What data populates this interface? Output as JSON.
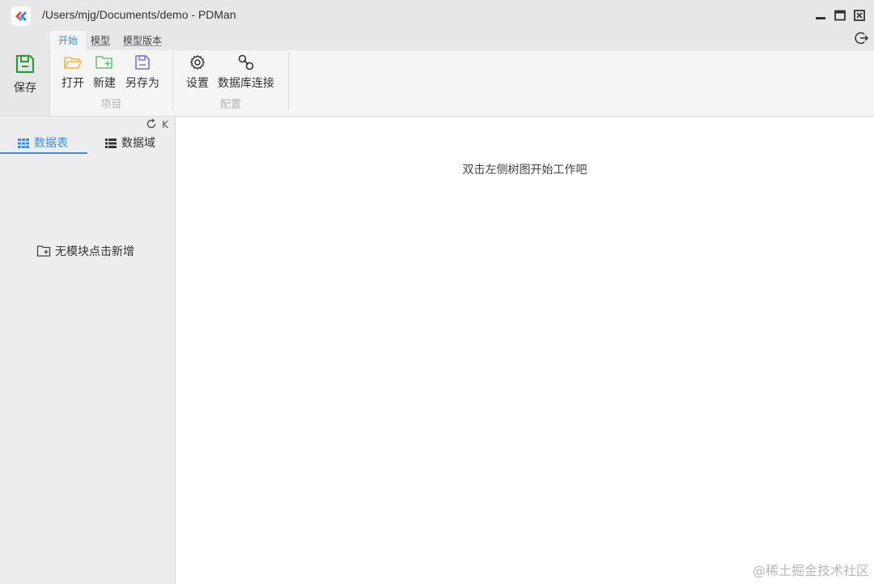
{
  "window": {
    "title": "/Users/mjg/Documents/demo - PDMan"
  },
  "ribbon_tabs": [
    {
      "label": "开始",
      "active": true
    },
    {
      "label": "模型",
      "active": false
    },
    {
      "label": "模型版本",
      "active": false
    }
  ],
  "ribbon": {
    "save_label": "保存",
    "project_group": {
      "label": "项目",
      "buttons": [
        {
          "label": "打开",
          "icon": "folder-open-icon"
        },
        {
          "label": "新建",
          "icon": "folder-add-icon"
        },
        {
          "label": "另存为",
          "icon": "save-as-icon"
        }
      ]
    },
    "config_group": {
      "label": "配置",
      "buttons": [
        {
          "label": "设置",
          "icon": "gear-icon"
        },
        {
          "label": "数据库连接",
          "icon": "link-icon"
        }
      ]
    }
  },
  "sidebar": {
    "tools": {
      "collapse_label": "K"
    },
    "tabs": [
      {
        "label": "数据表",
        "active": true,
        "icon": "grid-icon"
      },
      {
        "label": "数据域",
        "active": false,
        "icon": "list-icon"
      }
    ],
    "empty_text": "无模块点击新增"
  },
  "main": {
    "hint": "双击左侧树图开始工作吧"
  },
  "watermark": "@稀土掘金技术社区",
  "colors": {
    "accent": "#3a8ee6",
    "save_green": "#2e9a3c",
    "folder_yellow": "#f2b93b",
    "folder_green": "#6fbf73",
    "save_as_purple": "#7c74d6"
  }
}
